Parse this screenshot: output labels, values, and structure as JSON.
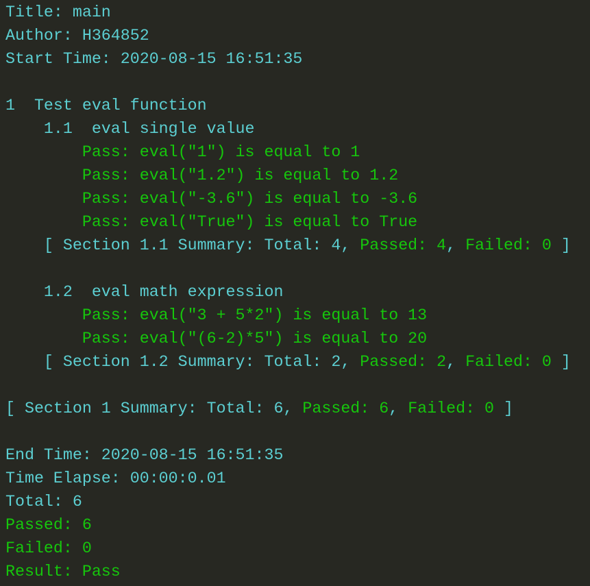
{
  "colors": {
    "background": "#272822",
    "info": "#5ccfd2",
    "pass": "#16c60c"
  },
  "lines": [
    {
      "segs": [
        {
          "t": "Title: main",
          "c": "c"
        }
      ]
    },
    {
      "segs": [
        {
          "t": "Author: H364852",
          "c": "c"
        }
      ]
    },
    {
      "segs": [
        {
          "t": "Start Time: 2020-08-15 16:51:35",
          "c": "c"
        }
      ]
    },
    {
      "segs": []
    },
    {
      "segs": [
        {
          "t": "1  Test eval function",
          "c": "c"
        }
      ]
    },
    {
      "segs": [
        {
          "t": "    1.1  eval single value",
          "c": "c"
        }
      ]
    },
    {
      "segs": [
        {
          "t": "        Pass: eval(\"1\") is equal to 1",
          "c": "g"
        }
      ]
    },
    {
      "segs": [
        {
          "t": "        Pass: eval(\"1.2\") is equal to 1.2",
          "c": "g"
        }
      ]
    },
    {
      "segs": [
        {
          "t": "        Pass: eval(\"-3.6\") is equal to -3.6",
          "c": "g"
        }
      ]
    },
    {
      "segs": [
        {
          "t": "        Pass: eval(\"True\") is equal to True",
          "c": "g"
        }
      ]
    },
    {
      "segs": [
        {
          "t": "    [ Section 1.1 Summary: Total: 4, ",
          "c": "c"
        },
        {
          "t": "Passed: 4",
          "c": "g"
        },
        {
          "t": ", ",
          "c": "c"
        },
        {
          "t": "Failed: 0",
          "c": "g"
        },
        {
          "t": " ]",
          "c": "c"
        }
      ]
    },
    {
      "segs": []
    },
    {
      "segs": [
        {
          "t": "    1.2  eval math expression",
          "c": "c"
        }
      ]
    },
    {
      "segs": [
        {
          "t": "        Pass: eval(\"3 + 5*2\") is equal to 13",
          "c": "g"
        }
      ]
    },
    {
      "segs": [
        {
          "t": "        Pass: eval(\"(6-2)*5\") is equal to 20",
          "c": "g"
        }
      ]
    },
    {
      "segs": [
        {
          "t": "    [ Section 1.2 Summary: Total: 2, ",
          "c": "c"
        },
        {
          "t": "Passed: 2",
          "c": "g"
        },
        {
          "t": ", ",
          "c": "c"
        },
        {
          "t": "Failed: 0",
          "c": "g"
        },
        {
          "t": " ]",
          "c": "c"
        }
      ]
    },
    {
      "segs": []
    },
    {
      "segs": [
        {
          "t": "[ Section 1 Summary: Total: 6, ",
          "c": "c"
        },
        {
          "t": "Passed: 6",
          "c": "g"
        },
        {
          "t": ", ",
          "c": "c"
        },
        {
          "t": "Failed: 0",
          "c": "g"
        },
        {
          "t": " ]",
          "c": "c"
        }
      ]
    },
    {
      "segs": []
    },
    {
      "segs": [
        {
          "t": "End Time: 2020-08-15 16:51:35",
          "c": "c"
        }
      ]
    },
    {
      "segs": [
        {
          "t": "Time Elapse: 00:00:0.01",
          "c": "c"
        }
      ]
    },
    {
      "segs": [
        {
          "t": "Total: 6",
          "c": "c"
        }
      ]
    },
    {
      "segs": [
        {
          "t": "Passed: 6",
          "c": "g"
        }
      ]
    },
    {
      "segs": [
        {
          "t": "Failed: 0",
          "c": "g"
        }
      ]
    },
    {
      "segs": [
        {
          "t": "Result: Pass",
          "c": "g"
        }
      ]
    }
  ]
}
